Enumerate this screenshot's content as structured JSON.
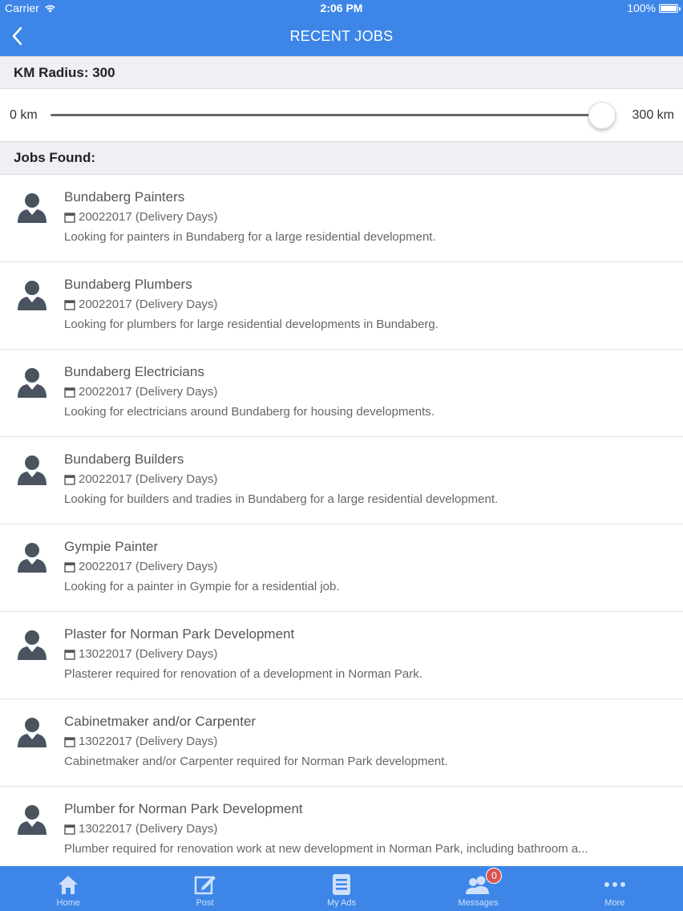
{
  "status_bar": {
    "carrier": "Carrier",
    "time": "2:06 PM",
    "battery": "100%"
  },
  "nav": {
    "title": "RECENT JOBS"
  },
  "radius": {
    "header": "KM Radius: 300",
    "min_label": "0 km",
    "max_label": "300 km",
    "value_fraction": 1.0
  },
  "jobs_header": "Jobs Found:",
  "jobs": [
    {
      "title": "Bundaberg Painters",
      "date": "20022017 (Delivery Days)",
      "desc": "Looking for painters in Bundaberg for a large residential development."
    },
    {
      "title": "Bundaberg Plumbers",
      "date": "20022017 (Delivery Days)",
      "desc": "Looking for plumbers for large residential developments in Bundaberg."
    },
    {
      "title": "Bundaberg Electricians",
      "date": "20022017 (Delivery Days)",
      "desc": "Looking for electricians around Bundaberg for housing developments."
    },
    {
      "title": "Bundaberg Builders",
      "date": "20022017 (Delivery Days)",
      "desc": "Looking for builders and tradies in Bundaberg for a large residential development."
    },
    {
      "title": "Gympie Painter",
      "date": "20022017 (Delivery Days)",
      "desc": "Looking for a painter in Gympie for a residential job."
    },
    {
      "title": "Plaster for Norman Park Development",
      "date": "13022017 (Delivery Days)",
      "desc": "Plasterer required for renovation of a development in Norman Park."
    },
    {
      "title": "Cabinetmaker and/or Carpenter",
      "date": "13022017 (Delivery Days)",
      "desc": "Cabinetmaker and/or Carpenter required for Norman Park development."
    },
    {
      "title": "Plumber for Norman Park Development",
      "date": "13022017 (Delivery Days)",
      "desc": "Plumber required for renovation work at new development in Norman Park, including bathroom a..."
    }
  ],
  "tabs": [
    {
      "label": "Home",
      "icon": "home-icon"
    },
    {
      "label": "Post",
      "icon": "edit-icon"
    },
    {
      "label": "My Ads",
      "icon": "document-icon"
    },
    {
      "label": "Messages",
      "icon": "users-icon",
      "badge": "0"
    },
    {
      "label": "More",
      "icon": "more-icon"
    }
  ],
  "colors": {
    "primary": "#3d86e8",
    "badge": "#d9534f"
  }
}
